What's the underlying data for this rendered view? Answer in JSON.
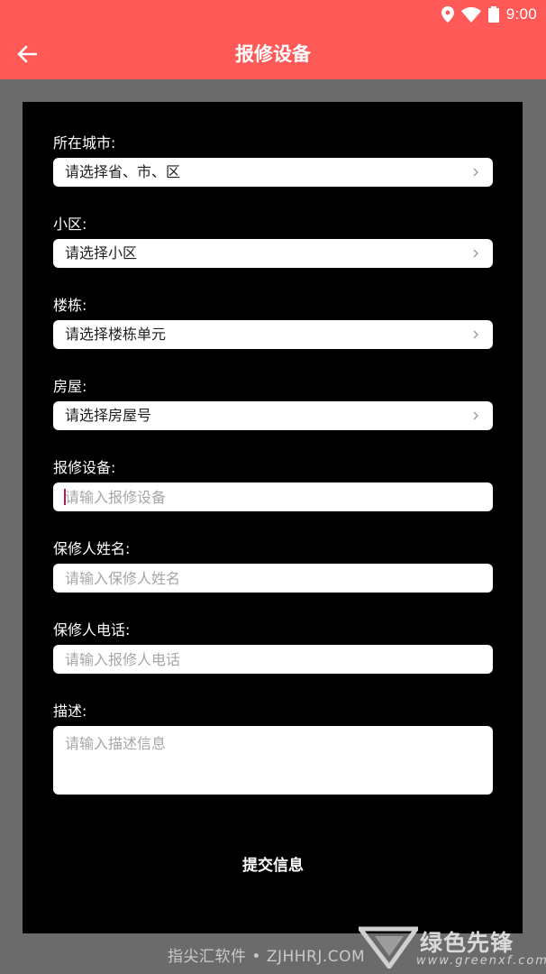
{
  "status_bar": {
    "time": "9:00"
  },
  "toolbar": {
    "title": "报修设备"
  },
  "form": {
    "city": {
      "label": "所在城市:",
      "value": "请选择省、市、区"
    },
    "community": {
      "label": "小区:",
      "value": "请选择小区"
    },
    "building": {
      "label": "楼栋:",
      "value": "请选择楼栋单元"
    },
    "house": {
      "label": "房屋:",
      "value": "请选择房屋号"
    },
    "device": {
      "label": "报修设备:",
      "placeholder": "请输入报修设备"
    },
    "name": {
      "label": "保修人姓名:",
      "placeholder": "请输入保修人姓名"
    },
    "phone": {
      "label": "保修人电话:",
      "placeholder": "请输入报修人电话"
    },
    "description": {
      "label": "描述:",
      "placeholder": "请输入描述信息"
    },
    "submit_label": "提交信息"
  },
  "watermark": {
    "left_text": "指尖汇软件 • ZJHHRJ.COM",
    "logo_text": "绿色先锋",
    "logo_url": "www.greenxf.com"
  },
  "colors": {
    "accent": "#ff5a57",
    "card_background": "#000000",
    "page_background": "#6b6b6b",
    "caret": "#c2185b"
  }
}
